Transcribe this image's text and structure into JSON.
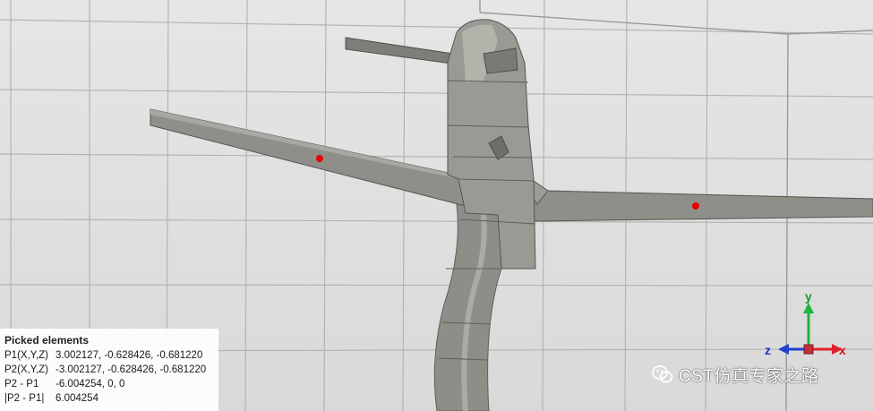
{
  "picked_panel": {
    "title": "Picked elements",
    "rows": [
      {
        "label": "P1(X,Y,Z)",
        "value": "3.002127, -0.628426, -0.681220"
      },
      {
        "label": "P2(X,Y,Z)",
        "value": "-3.002127, -0.628426, -0.681220"
      },
      {
        "label": "P2 - P1",
        "value": "-6.004254, 0, 0"
      },
      {
        "label": "|P2 - P1|",
        "value": "6.004254"
      }
    ]
  },
  "axes": {
    "x_label": "x",
    "y_label": "y",
    "z_label": "z"
  },
  "watermark": {
    "text": "CST仿真专家之路",
    "icon": "wechat-icon"
  },
  "colors": {
    "pick_point": "#e60000",
    "model_gray": "#8f8f8a",
    "grid_line": "#b4b4b4",
    "axis_x": "#e0202a",
    "axis_y": "#1fb33a",
    "axis_z": "#1f3fd0"
  }
}
